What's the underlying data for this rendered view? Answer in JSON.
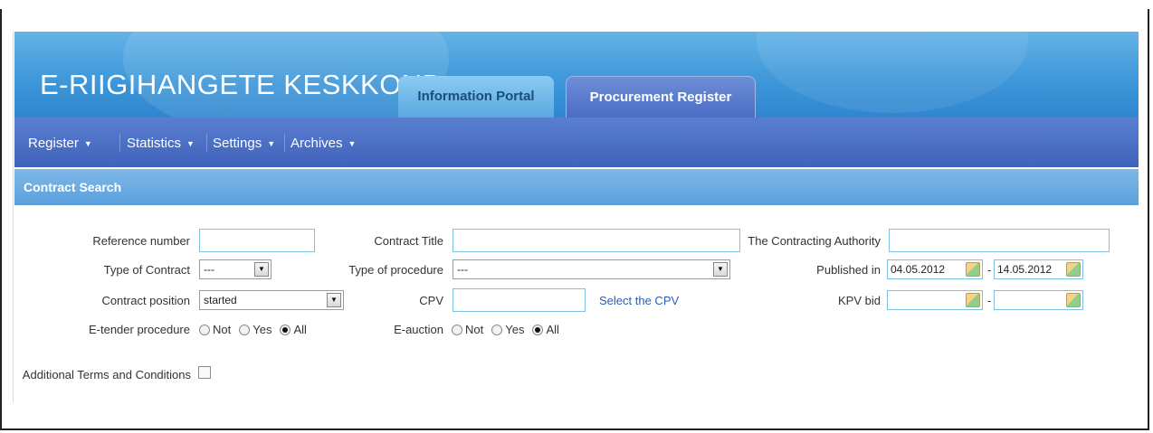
{
  "header": {
    "brand": "E-RIIGIHANGETE KESKKOND",
    "tabs": [
      {
        "label": "Information Portal",
        "active": false
      },
      {
        "label": "Procurement Register",
        "active": true
      }
    ]
  },
  "menu": [
    {
      "label": "Register"
    },
    {
      "label": "Statistics"
    },
    {
      "label": "Settings"
    },
    {
      "label": "Archives"
    }
  ],
  "section": {
    "title": "Contract Search"
  },
  "form": {
    "reference_number": {
      "label": "Reference number",
      "value": ""
    },
    "contract_title": {
      "label": "Contract Title",
      "value": ""
    },
    "contracting_authority": {
      "label": "The Contracting Authority",
      "value": ""
    },
    "type_of_contract": {
      "label": "Type of Contract",
      "value": "---"
    },
    "type_of_procedure": {
      "label": "Type of procedure",
      "value": "---"
    },
    "published_in": {
      "label": "Published in",
      "from": "04.05.2012",
      "to": "14.05.2012"
    },
    "contract_position": {
      "label": "Contract position",
      "value": "started"
    },
    "cpv": {
      "label": "CPV",
      "value": "",
      "link": "Select the CPV"
    },
    "kpv_bid": {
      "label": "KPV bid",
      "from": "",
      "to": ""
    },
    "e_tender": {
      "label": "E-tender procedure",
      "options": [
        "Not",
        "Yes",
        "All"
      ],
      "selected": "All"
    },
    "e_auction": {
      "label": "E-auction",
      "options": [
        "Not",
        "Yes",
        "All"
      ],
      "selected": "All"
    },
    "additional_terms": {
      "label": "Additional Terms and Conditions",
      "checked": false
    },
    "range_separator": "-"
  },
  "colors": {
    "header_blue": "#3f98d9",
    "menu_blue": "#4063bb",
    "section_blue": "#5a9fdc"
  }
}
